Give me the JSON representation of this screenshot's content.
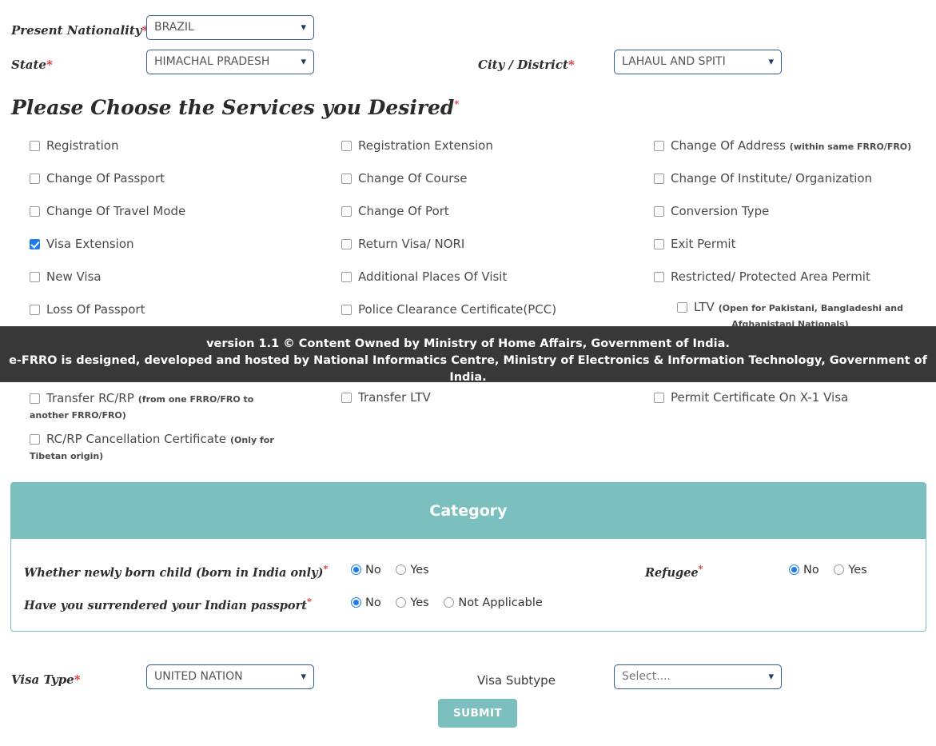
{
  "top_fields": [
    {
      "label": "Present Nationality",
      "required": true,
      "value": "BRAZIL",
      "name": "present-nationality"
    },
    {
      "label": "State",
      "required": true,
      "value": "HIMACHAL PRADESH",
      "name": "state"
    },
    {
      "label": "City / District",
      "required": true,
      "value": "LAHAUL AND SPITI",
      "name": "city-district"
    }
  ],
  "services_section": {
    "title": "Please Choose the Services you Desired",
    "required": true,
    "items": [
      {
        "label": "Registration",
        "note": "",
        "checked": false
      },
      {
        "label": "Registration Extension",
        "note": "",
        "checked": false
      },
      {
        "label": "Change Of Address",
        "note": "(within same FRRO/FRO)",
        "checked": false
      },
      {
        "label": "Change Of Passport",
        "note": "",
        "checked": false
      },
      {
        "label": "Change Of Course",
        "note": "",
        "checked": false
      },
      {
        "label": "Change Of Institute/ Organization",
        "note": "",
        "checked": false
      },
      {
        "label": "Change Of Travel Mode",
        "note": "",
        "checked": false
      },
      {
        "label": "Change Of Port",
        "note": "",
        "checked": false
      },
      {
        "label": "Conversion Type",
        "note": "",
        "checked": false
      },
      {
        "label": "Visa Extension",
        "note": "",
        "checked": true
      },
      {
        "label": "Return Visa/ NORI",
        "note": "",
        "checked": false
      },
      {
        "label": "Exit Permit",
        "note": "",
        "checked": false
      },
      {
        "label": "New Visa",
        "note": "",
        "checked": false
      },
      {
        "label": "Additional Places Of Visit",
        "note": "",
        "checked": false
      },
      {
        "label": "Restricted/ Protected Area Permit",
        "note": "",
        "checked": false
      },
      {
        "label": "Loss Of Passport",
        "note": "",
        "checked": false
      },
      {
        "label": "Police Clearance Certificate(PCC)",
        "note": "",
        "checked": false
      },
      {
        "label": "LTV",
        "note": "(Open for Pakistani, Bangladeshi and Afghanistani Nationals)",
        "checked": false
      },
      {
        "label": "Transfer RC/RP",
        "note": "(from one FRRO/FRO to another FRRO/FRO)",
        "checked": false
      },
      {
        "label": "Transfer LTV",
        "note": "",
        "checked": false
      },
      {
        "label": "Permit Certificate On X-1 Visa",
        "note": "",
        "checked": false
      },
      {
        "label": "RC/RP Cancellation Certificate",
        "note": "(Only for Tibetan origin)",
        "checked": false
      }
    ]
  },
  "footer_band": {
    "line1": "version 1.1 © Content Owned by Ministry of Home Affairs, Government of India.",
    "line2": "e-FRRO is designed, developed and hosted by National Informatics Centre, Ministry of Electronics & Information Technology, Government of India."
  },
  "category": {
    "header": "Category",
    "questions": [
      {
        "label": "Whether newly born child   (born in India only)",
        "required": true,
        "name": "newly-born-child",
        "options": [
          "No",
          "Yes"
        ],
        "selected": "No"
      },
      {
        "label": "Have you surrendered your Indian passport",
        "required": true,
        "name": "surrendered-indian-passport",
        "options": [
          "No",
          "Yes",
          "Not Applicable"
        ],
        "selected": "No"
      },
      {
        "label": "Refugee",
        "required": true,
        "name": "refugee",
        "options": [
          "No",
          "Yes"
        ],
        "selected": "No"
      }
    ]
  },
  "visa": {
    "type_label": "Visa Type",
    "type_required": true,
    "type_value": "UNITED NATION",
    "subtype_label": "Visa Subtype",
    "subtype_required": false,
    "subtype_value": "Select...."
  },
  "submit_label": "SUBMIT",
  "colors": {
    "teal": "#7bbfbe",
    "dark_band": "#383838",
    "select_border": "#2d5c93",
    "required_red": "#e03131",
    "checkbox_checked": "#1b7ced"
  }
}
